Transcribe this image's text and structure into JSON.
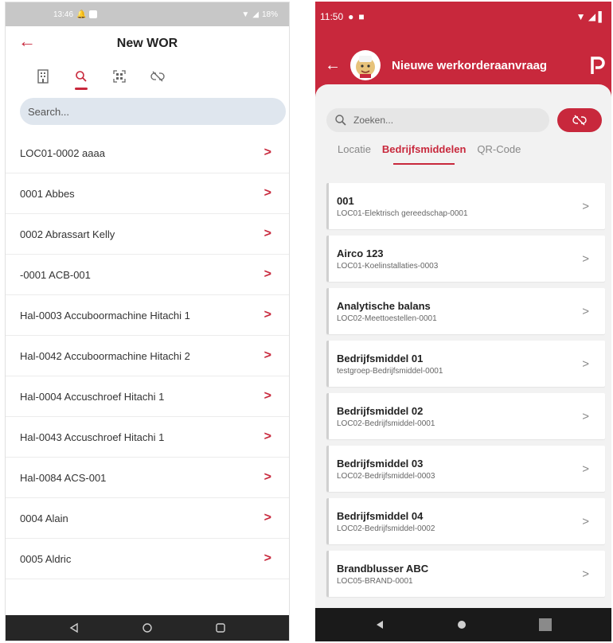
{
  "left": {
    "status": {
      "time": "13:46",
      "battery": "18%"
    },
    "header": {
      "back": "←",
      "title": "New WOR"
    },
    "tabs": [
      {
        "name": "building-icon",
        "active": false
      },
      {
        "name": "search-icon",
        "active": true
      },
      {
        "name": "qr-scan-icon",
        "active": false
      },
      {
        "name": "unlink-icon",
        "active": false
      }
    ],
    "search": {
      "placeholder": "Search..."
    },
    "items": [
      "LOC01-0002 aaaa",
      "0001 Abbes",
      "0002 Abrassart Kelly",
      "-0001 ACB-001",
      "Hal-0003 Accuboormachine Hitachi 1",
      "Hal-0042 Accuboormachine Hitachi 2",
      "Hal-0004 Accuschroef Hitachi 1",
      "Hal-0043 Accuschroef Hitachi 1",
      "Hal-0084 ACS-001",
      "0004 Alain",
      "0005 Aldric"
    ],
    "chevron": ">"
  },
  "right": {
    "status": {
      "time": "11:50"
    },
    "appbar": {
      "back": "←",
      "title": "Nieuwe werkorderaanvraag"
    },
    "search": {
      "placeholder": "Zoeken..."
    },
    "tabs": [
      "Locatie",
      "Bedrijfsmiddelen",
      "QR-Code"
    ],
    "active_tab": 1,
    "items": [
      {
        "title": "001",
        "subtitle": "LOC01-Elektrisch gereedschap-0001"
      },
      {
        "title": "Airco 123",
        "subtitle": "LOC01-Koelinstallaties-0003"
      },
      {
        "title": "Analytische balans",
        "subtitle": "LOC02-Meettoestellen-0001"
      },
      {
        "title": "Bedrijfsmiddel 01",
        "subtitle": "testgroep-Bedrijfsmiddel-0001"
      },
      {
        "title": "Bedrijfsmiddel 02",
        "subtitle": "LOC02-Bedrijfsmiddel-0001"
      },
      {
        "title": "Bedrijfsmiddel 03",
        "subtitle": "LOC02-Bedrijfsmiddel-0003"
      },
      {
        "title": "Bedrijfsmiddel 04",
        "subtitle": "LOC02-Bedrijfsmiddel-0002"
      },
      {
        "title": "Brandblusser ABC",
        "subtitle": "LOC05-BRAND-0001"
      }
    ],
    "chevron": ">"
  },
  "colors": {
    "accent": "#c8283c",
    "search_bg_left": "#dfe6ee",
    "navbar": "#262626"
  }
}
